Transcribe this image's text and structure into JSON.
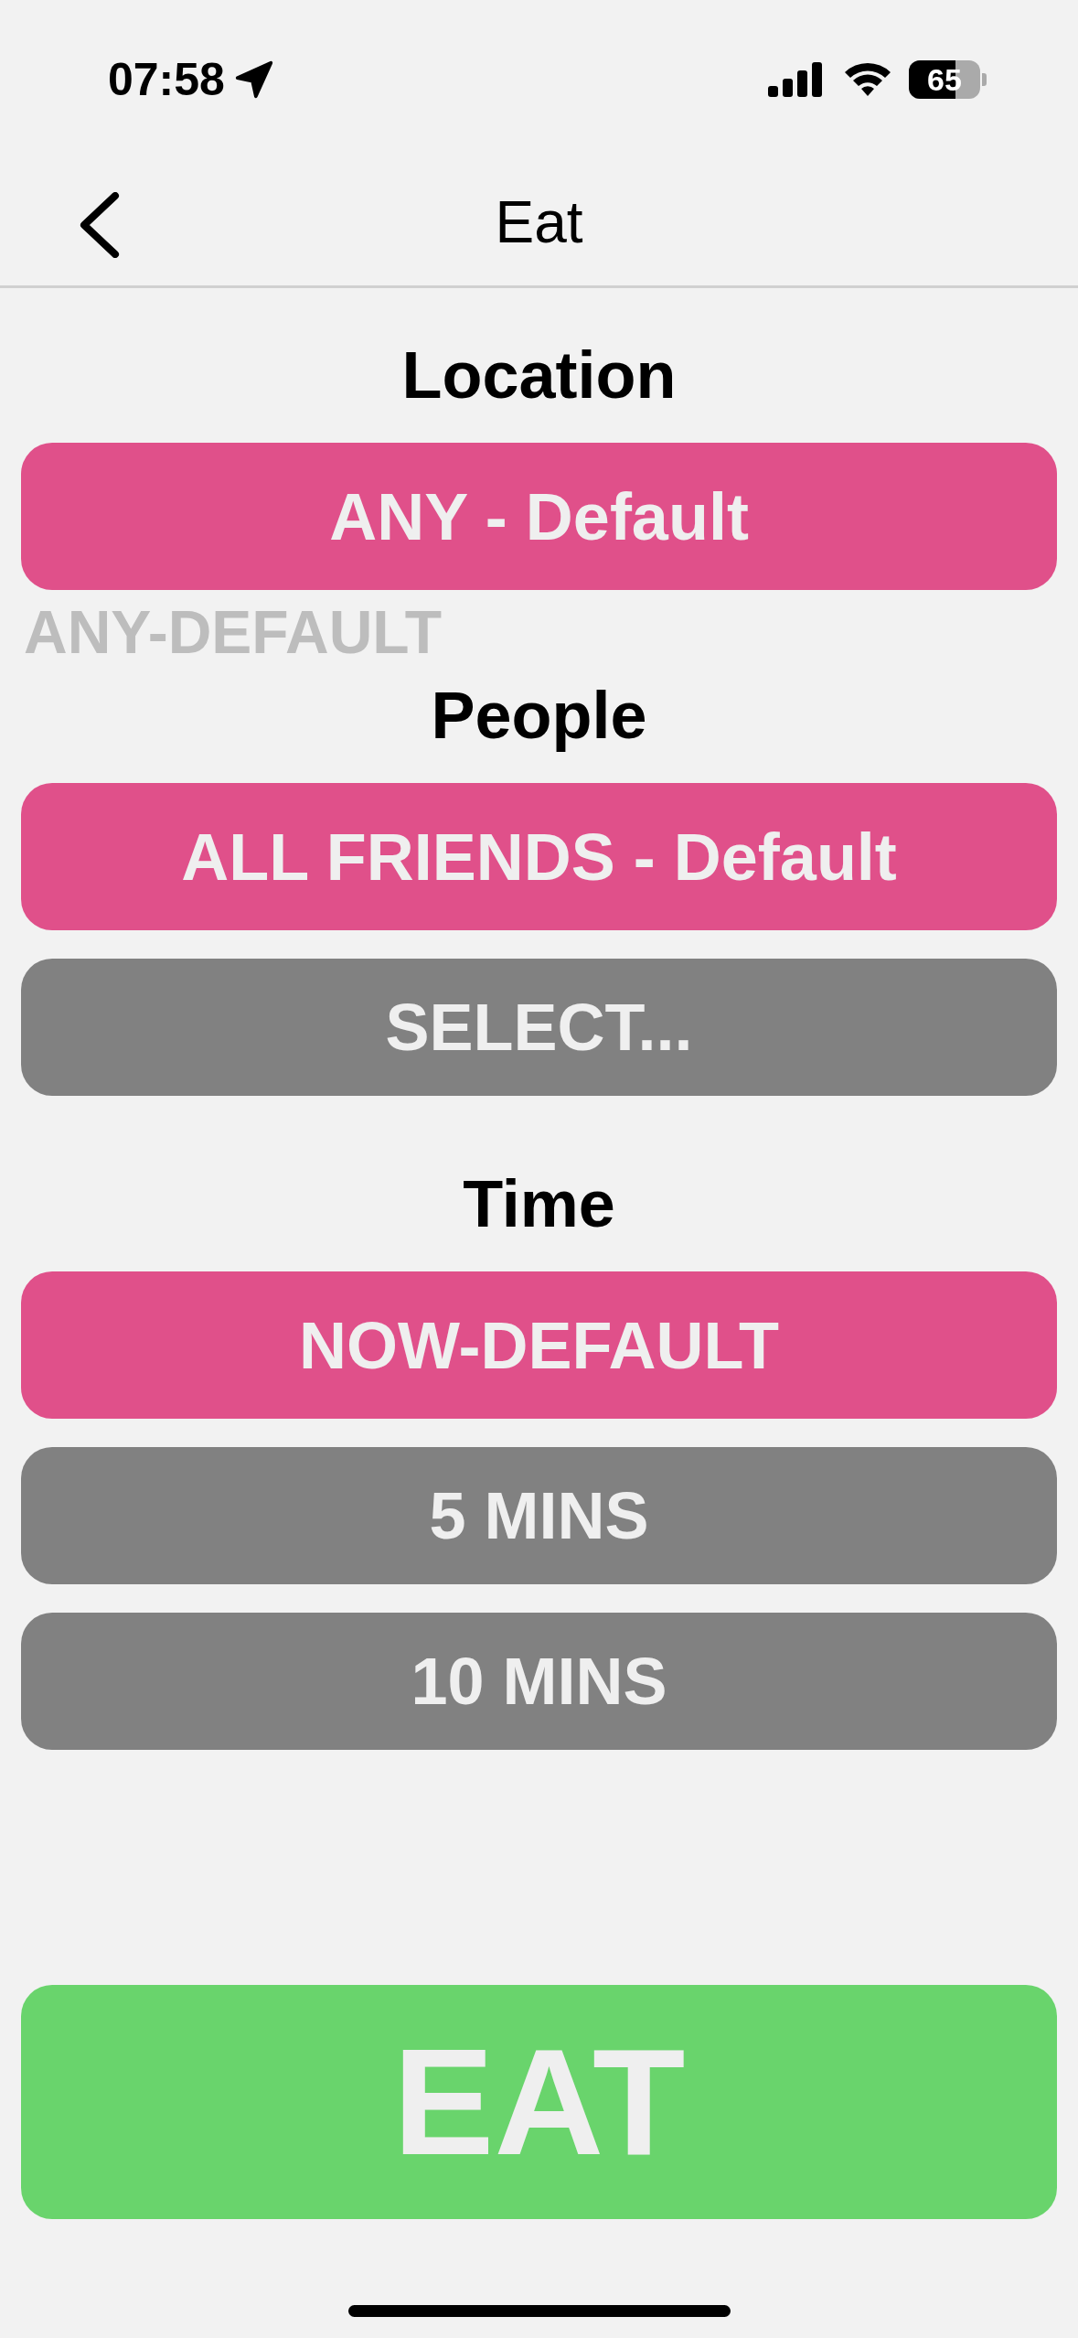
{
  "status_bar": {
    "time": "07:58",
    "battery": "65"
  },
  "nav": {
    "title": "Eat"
  },
  "sections": [
    {
      "heading": "Location",
      "options": [
        {
          "label": "ANY - Default",
          "selected": true
        }
      ],
      "hint": "ANY-DEFAULT"
    },
    {
      "heading": "People",
      "options": [
        {
          "label": "ALL FRIENDS - Default",
          "selected": true
        },
        {
          "label": "SELECT...",
          "selected": false
        }
      ]
    },
    {
      "heading": "Time",
      "options": [
        {
          "label": "NOW-DEFAULT",
          "selected": true
        },
        {
          "label": "5 MINS",
          "selected": false
        },
        {
          "label": "10 MINS",
          "selected": false
        }
      ]
    }
  ],
  "action": {
    "label": "EAT"
  }
}
